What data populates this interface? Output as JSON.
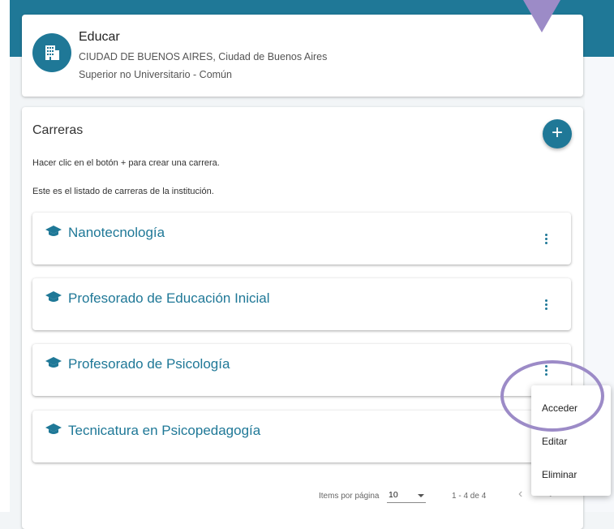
{
  "institution": {
    "name": "Educar",
    "location": "CIUDAD DE BUENOS AIRES, Ciudad de Buenos Aires",
    "level": "Superior no Universitario - Común",
    "icon": "building-icon"
  },
  "careers_section": {
    "title": "Carreras",
    "add_button_label": "+",
    "hint_create": "Hacer clic en el botón + para crear una carrera.",
    "hint_list": "Este es el listado de carreras de la institución."
  },
  "careers": [
    {
      "title": "Nanotecnología"
    },
    {
      "title": "Profesorado de Educación Inicial"
    },
    {
      "title": "Profesorado de Psicología"
    },
    {
      "title": "Tecnicatura en Psicopedagogía"
    }
  ],
  "context_menu": {
    "items": [
      "Acceder",
      "Editar",
      "Eliminar"
    ]
  },
  "paginator": {
    "items_per_page_label": "Items por página",
    "page_size": "10",
    "range": "1 - 4 de 4",
    "prev_label": "‹",
    "next_label": "›"
  },
  "colors": {
    "primary": "#1f7897",
    "highlight": "#9c8bc7"
  }
}
